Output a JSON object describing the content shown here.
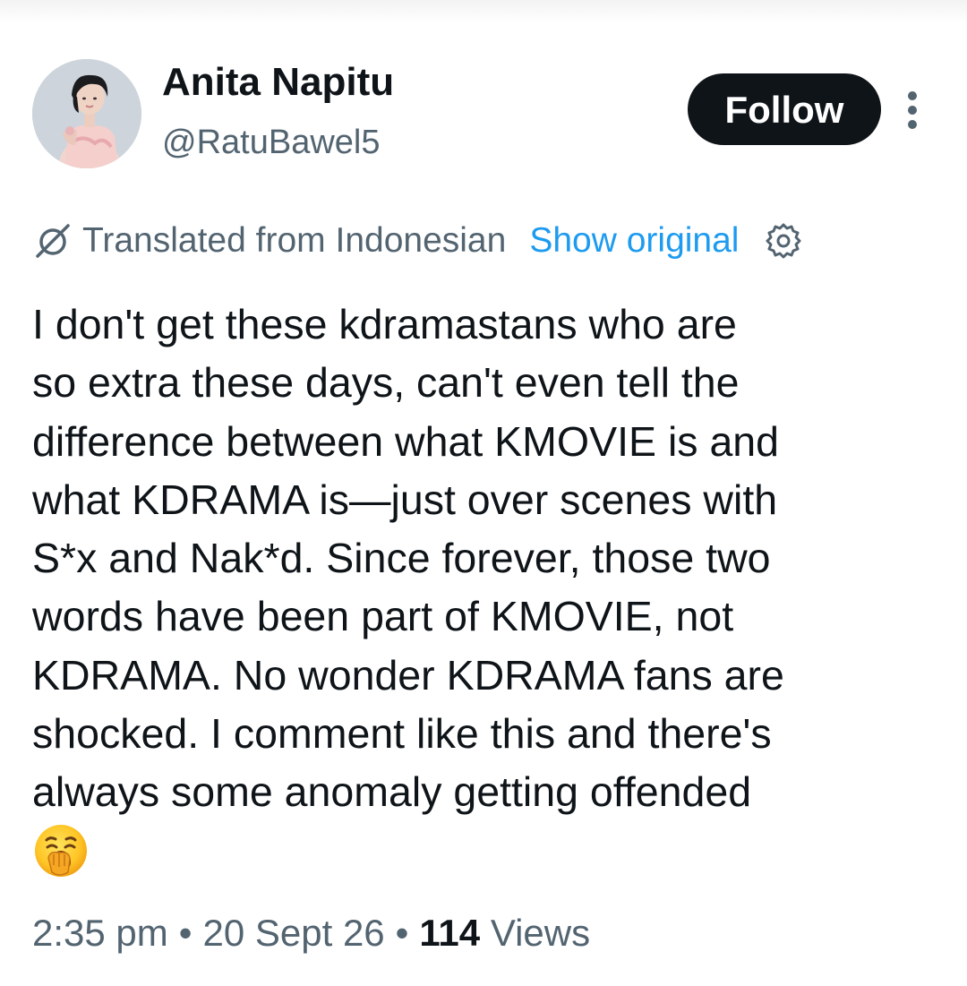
{
  "colors": {
    "text_primary": "#0f1419",
    "text_secondary": "#536471",
    "link_blue": "#1d9bf0",
    "button_bg": "#0f1419",
    "button_text": "#ffffff"
  },
  "author": {
    "display_name": "Anita Napitu",
    "handle": "@RatuBawel5",
    "avatar_icon": "profile-photo"
  },
  "actions": {
    "follow_label": "Follow",
    "more_icon": "vertical-ellipsis-icon"
  },
  "translation": {
    "icon": "translate-slash-icon",
    "label": "Translated from Indonesian",
    "show_original_label": "Show original",
    "settings_icon": "gear-icon"
  },
  "tweet": {
    "lines": [
      "I don't get these kdramastans who are",
      "so extra these days, can't even tell the",
      "difference between what KMOVIE is and",
      "what KDRAMA is—just over scenes with",
      "S*x and Nak*d. Since forever, those two",
      "words have been part of KMOVIE, not",
      "KDRAMA. No wonder KDRAMA fans are",
      "shocked. I comment like this and there's",
      "always some anomaly getting offended"
    ],
    "emoji": "yawning-face"
  },
  "meta": {
    "time": "2:35 pm",
    "separator": "•",
    "date": "20 Sept 26",
    "views_count": "114",
    "views_label": "Views"
  }
}
